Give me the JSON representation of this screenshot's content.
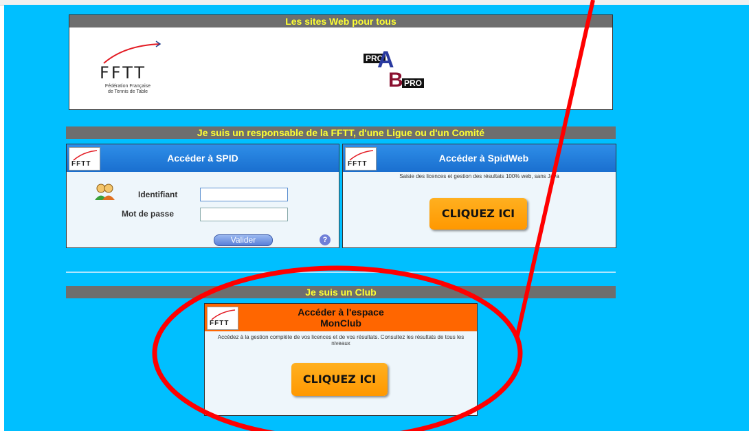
{
  "top_banner": {
    "title": "Les sites Web pour tous",
    "fftt_logo": {
      "letters": "FFTT",
      "line1": "Fédération Française",
      "line2": "de Tennis de Table"
    },
    "pro_logo": {
      "pro_a": "PRO",
      "a": "A",
      "b": "B",
      "pro_b": "PRO"
    }
  },
  "responsable_section": {
    "title": "Je suis un responsable de la FFTT, d'une Ligue ou d'un Comité",
    "spid": {
      "header": "Accéder à SPID",
      "identifiant_label": "Identifiant",
      "identifiant_value": "",
      "password_label": "Mot de passe",
      "password_value": "",
      "validate_button": "Valider",
      "help_glyph": "?"
    },
    "spidweb": {
      "header": "Accéder à SpidWeb",
      "description": "Saisie des licences et gestion des résultats 100% web, sans Java",
      "cta": "CLIQUEZ ICI"
    }
  },
  "club_section": {
    "title": "Je suis un Club",
    "header_line1": "Accéder à l'espace",
    "header_line2": "MonClub",
    "description": "Accédez à la gestion complète de vos licences et de vos résultats. Consultez les résultats de tous les niveaux",
    "cta": "CLIQUEZ ICI"
  },
  "mini_logo": "FFTT",
  "colors": {
    "page_background": "#00bfff",
    "section_bar": "#6e6e6e",
    "section_title": "#ffff33",
    "spid_header": "#1a6fcf",
    "monclub_header": "#ff6600",
    "cta_button": "#ff9800",
    "annotation": "#ff0000"
  }
}
